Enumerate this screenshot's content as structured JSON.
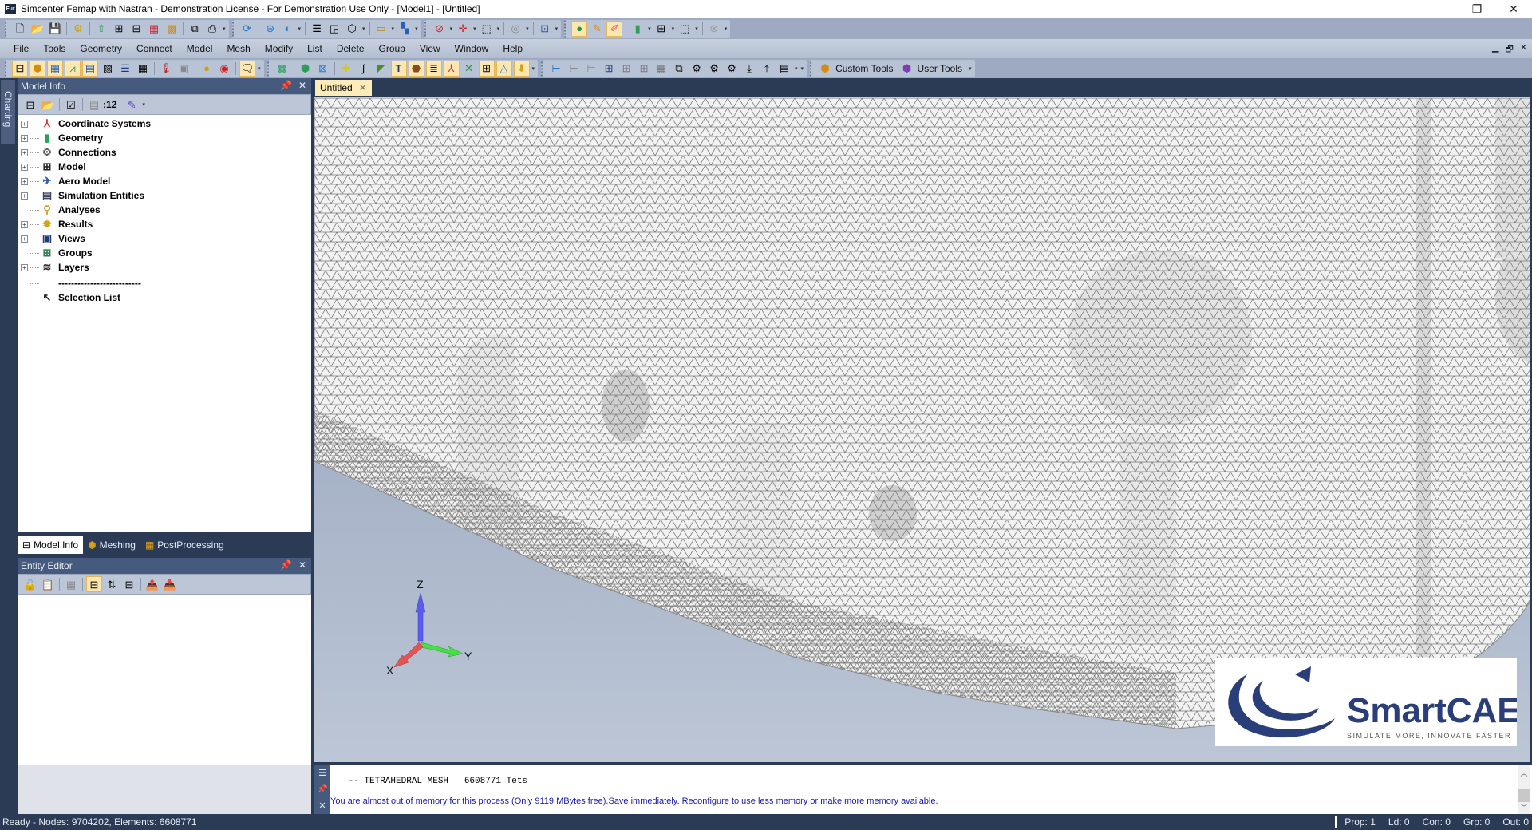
{
  "window": {
    "app_icon_text": "Fur",
    "title": "Simcenter Femap with Nastran - Demonstration License - For Demonstration Use Only - [Model1] - [Untitled]",
    "controls": {
      "minimize": "—",
      "restore": "❐",
      "close": "✕"
    }
  },
  "toolbar_top": {
    "groups": [
      {
        "icons": [
          "new-file-icon",
          "open-folder-icon",
          "save-icon",
          "gears-icon",
          "import-geometry-icon",
          "import-model-icon",
          "export-model-icon",
          "results-import-icon",
          "file-open-results-icon",
          "copy-icon",
          "print-icon"
        ]
      },
      {
        "icons": [
          "regenerate-icon",
          "dynamic-rotate-icon",
          "view-options-icon",
          "view-select-icon",
          "box-view-icon",
          "measure-icon",
          "color-contour-icon"
        ]
      },
      {
        "icons": [
          "clear-selection-icon",
          "select-pick-icon",
          "select-box-icon",
          "snap-icon",
          "workplane-icon"
        ]
      },
      {
        "icons": [
          "show-entity-icon",
          "draw-pencil-icon",
          "erase-icon",
          "show-solid-icon",
          "show-mesh-icon",
          "show-box-icon",
          "cancel-icon"
        ]
      }
    ]
  },
  "menu": {
    "items": [
      "File",
      "Tools",
      "Geometry",
      "Connect",
      "Model",
      "Mesh",
      "Modify",
      "List",
      "Delete",
      "Group",
      "View",
      "Window",
      "Help"
    ],
    "mdi_controls": {
      "minimize": "▁",
      "restore": "🗗",
      "close": "✕"
    }
  },
  "toolbar_second": {
    "custom_tools_label": "Custom Tools",
    "user_tools_label": "User Tools"
  },
  "left_dock": {
    "charting_tab": "Charting",
    "model_info": {
      "title": "Model Info",
      "toolbar_count": ":12",
      "tree": [
        {
          "label": "Coordinate Systems",
          "icon": "coordinate-systems-icon",
          "glyph": "⅄",
          "color": "#d9302c",
          "expandable": true
        },
        {
          "label": "Geometry",
          "icon": "geometry-icon",
          "glyph": "▮",
          "color": "#2e9d5a",
          "expandable": true
        },
        {
          "label": "Connections",
          "icon": "connections-icon",
          "glyph": "⚙",
          "color": "#555555",
          "expandable": true
        },
        {
          "label": "Model",
          "icon": "model-icon",
          "glyph": "⊞",
          "color": "#222222",
          "expandable": true
        },
        {
          "label": "Aero Model",
          "icon": "aero-model-icon",
          "glyph": "✈",
          "color": "#2b5fb5",
          "expandable": true
        },
        {
          "label": "Simulation Entities",
          "icon": "simulation-entities-icon",
          "glyph": "▤",
          "color": "#3a4660",
          "expandable": true
        },
        {
          "label": "Analyses",
          "icon": "analyses-icon",
          "glyph": "⚲",
          "color": "#c79a10",
          "expandable": false
        },
        {
          "label": "Results",
          "icon": "results-icon",
          "glyph": "✹",
          "color": "#d3a412",
          "expandable": true
        },
        {
          "label": "Views",
          "icon": "views-icon",
          "glyph": "▣",
          "color": "#1f3b78",
          "expandable": true
        },
        {
          "label": "Groups",
          "icon": "groups-icon",
          "glyph": "⊞",
          "color": "#2e7d52",
          "expandable": false
        },
        {
          "label": "Layers",
          "icon": "layers-icon",
          "glyph": "≋",
          "color": "#222222",
          "expandable": true
        },
        {
          "label": "--------------------------",
          "icon": "separator-icon",
          "glyph": "",
          "color": "#000000",
          "expandable": false
        },
        {
          "label": "Selection List",
          "icon": "cursor-icon",
          "glyph": "↖",
          "color": "#222222",
          "expandable": false
        }
      ]
    },
    "tabs": [
      {
        "label": "Model Info",
        "active": true
      },
      {
        "label": "Meshing",
        "active": false
      },
      {
        "label": "PostProcessing",
        "active": false
      }
    ],
    "entity_editor": {
      "title": "Entity Editor"
    }
  },
  "document": {
    "tab_label": "Untitled",
    "tab_close": "✕",
    "triad": {
      "x": "X",
      "y": "Y",
      "z": "Z"
    },
    "logo": {
      "name": "SmartCAE",
      "tagline": "SIMULATE MORE, INNOVATE FASTER",
      "color": "#2a3f7a"
    }
  },
  "messages": {
    "line1": " -- TETRAHEDRAL MESH   6608771 Tets",
    "line2": "You are almost out of memory for this process (Only 9119 MBytes free).Save immediately. Reconfigure to use less memory or make more memory available.",
    "line2_color": "#1a1aa6"
  },
  "status": {
    "left": "Ready - Nodes: 9704202,  Elements: 6608771",
    "prop": "Prop: 1",
    "ld": "Ld: 0",
    "con": "Con: 0",
    "grp": "Grp: 0",
    "out": "Out: 0"
  },
  "colors": {
    "chrome_dark": "#2b3a55",
    "toolbar_bg": "#9daac1",
    "panel_header": "#465a7d",
    "active_tab": "#fdebb8",
    "mesh_line": "#7a7a7a",
    "mesh_fill": "#f2f2f2"
  }
}
